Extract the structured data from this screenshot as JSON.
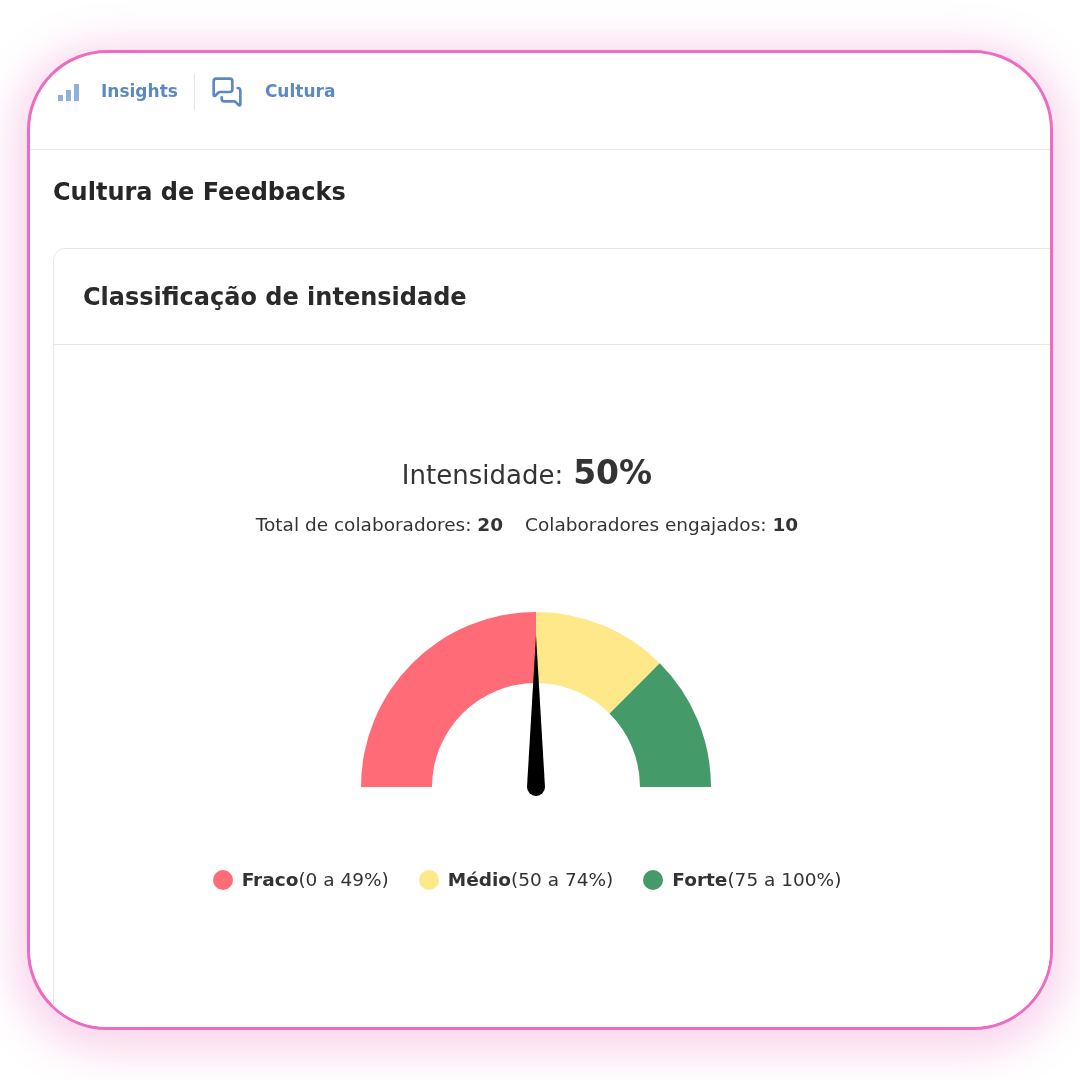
{
  "nav": {
    "links": [
      {
        "label": "Insights"
      },
      {
        "label": "Cultura"
      }
    ]
  },
  "page": {
    "title": "Cultura de Feedbacks"
  },
  "card": {
    "title": "Classificação de intensidade",
    "intensity": {
      "label": "Intensidade:",
      "value": "50%"
    },
    "stats": [
      "Total de colaboradores: **20**",
      "Colaboradores engajados: **10**"
    ],
    "gauge": {
      "chart_data": {
        "type": "donut",
        "categories": [
          "Fraco",
          "Médio",
          "Forte"
        ],
        "values": [
          50,
          25,
          25
        ]
      },
      "needle": {
        "level": 0.5
      },
      "legend": [
        {
          "range": "(0 a 49%)",
          "color": "#ff6b77"
        },
        {
          "range": "(50 a 74%)",
          "color": "#fee88a"
        },
        {
          "range": "(75 a 100%)",
          "color": "#459a69"
        }
      ]
    }
  }
}
